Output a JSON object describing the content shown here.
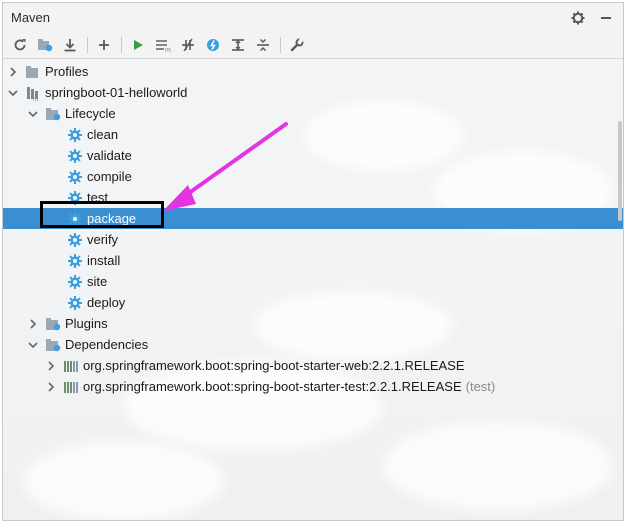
{
  "header": {
    "title": "Maven"
  },
  "toolbar": {
    "buttons": [
      "reload-icon",
      "generate-sources-icon",
      "download-icon",
      "add-icon",
      "run-icon",
      "execute-goal-icon",
      "toggle-offline-icon",
      "skip-tests-icon",
      "show-dependencies-icon",
      "collapse-all-icon",
      "settings-wrench-icon"
    ]
  },
  "tree": {
    "profiles": "Profiles",
    "project": "springboot-01-helloworld",
    "lifecycle": "Lifecycle",
    "lifecycle_items": [
      "clean",
      "validate",
      "compile",
      "test",
      "package",
      "verify",
      "install",
      "site",
      "deploy"
    ],
    "plugins": "Plugins",
    "dependencies": "Dependencies",
    "dependency_items": [
      {
        "name": "org.springframework.boot:spring-boot-starter-web:2.2.1.RELEASE",
        "scope": ""
      },
      {
        "name": "org.springframework.boot:spring-boot-starter-test:2.2.1.RELEASE",
        "scope": "(test)"
      }
    ],
    "selected": "package"
  },
  "colors": {
    "selection": "#3a8fd1",
    "annotation_arrow": "#e433e4",
    "gear": "#3d9ee0"
  }
}
